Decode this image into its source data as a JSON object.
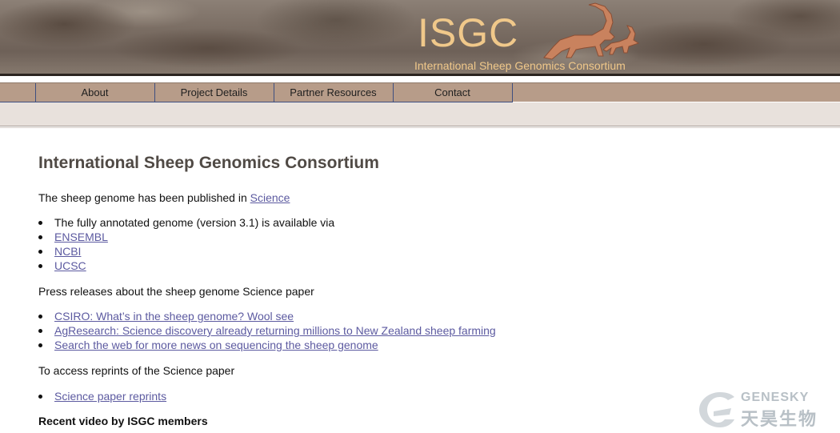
{
  "banner": {
    "title": "ISGC",
    "subtitle": "International Sheep Genomics Consortium"
  },
  "nav": {
    "items": [
      {
        "label": "About"
      },
      {
        "label": "Project Details"
      },
      {
        "label": "Partner Resources"
      },
      {
        "label": "Contact"
      }
    ]
  },
  "main": {
    "title": "International Sheep Genomics Consortium",
    "published_text": "The sheep genome has been published in ",
    "published_link": "Science",
    "genome_list": {
      "intro": "The fully annotated genome (version 3.1) is available via",
      "links": [
        "ENSEMBL",
        "NCBI",
        "UCSC"
      ]
    },
    "press_heading": "Press releases about the sheep genome Science paper",
    "press_links": [
      "CSIRO: What’s in the sheep genome? Wool see",
      "AgResearch: Science discovery already returning millions to New Zealand sheep farming",
      "Search the web for more news on sequencing the sheep genome"
    ],
    "reprints_heading": "To access reprints of the Science paper",
    "reprints_link": "Science paper reprints",
    "video_heading": "Recent video by ISGC members"
  },
  "watermark": {
    "text_en": "GENESKY",
    "text_cn": "天昊生物"
  },
  "colors": {
    "link": "#5c5aa0",
    "nav_bar": "#b79c89",
    "subnav_bar": "#e8e1dc",
    "logo_text": "#f0c88a",
    "title_text": "#504a45"
  }
}
